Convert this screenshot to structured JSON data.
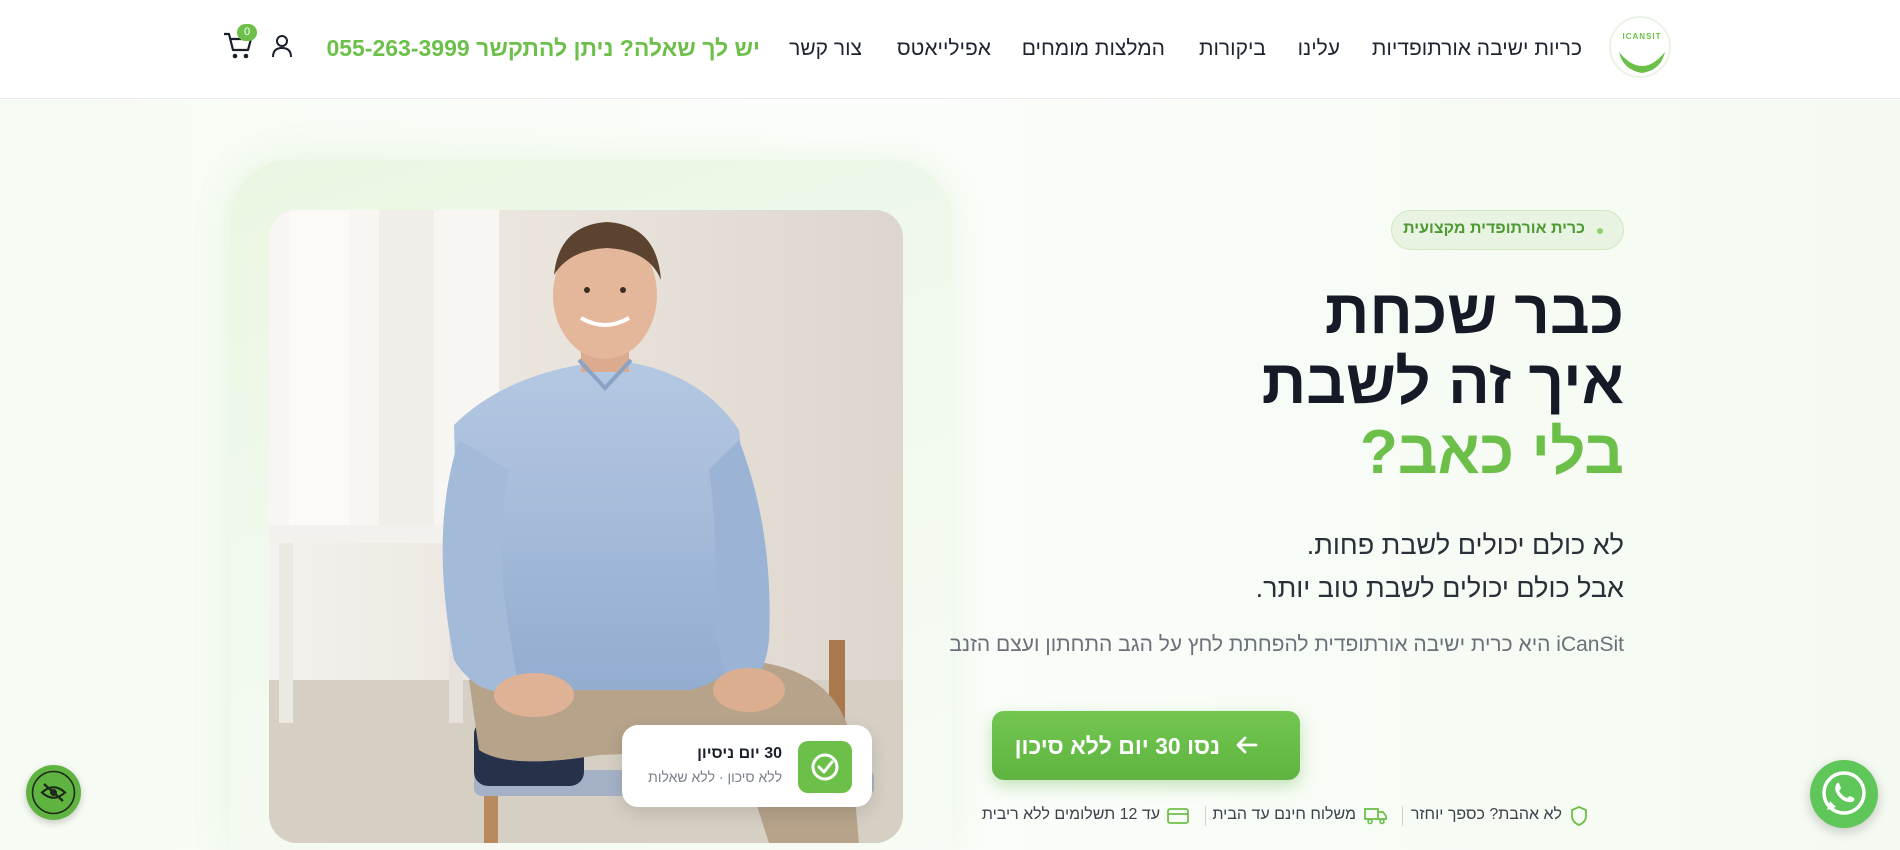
{
  "brand": {
    "logo_text": "ICANSIT",
    "accent_color": "#6cc04a"
  },
  "nav": {
    "items": [
      "כריות ישיבה אורתופדיות",
      "עלינו",
      "ביקורות",
      "המלצות מומחים",
      "אפילייאטס",
      "צור קשר"
    ],
    "phone_cta": "יש לך שאלה? ניתן להתקשר 055-263-3999",
    "cart_count": "0"
  },
  "hero": {
    "badge": "כרית אורתופדית מקצועית",
    "headline_line1": "כבר שכחת",
    "headline_line2": "איך זה לשבת",
    "headline_line3": "בלי כאב?",
    "subline1": "לא כולם יכולים לשבת פחות.",
    "subline2": "אבל כולם יכולים לשבת טוב יותר.",
    "description": "iCanSit היא כרית ישיבה אורתופדית להפחתת לחץ על הגב התחתון ועצם הזנב",
    "cta_label": "נסו 30 יום ללא סיכון",
    "trial_card": {
      "title": "30 יום ניסיון",
      "subtitle": "ללא סיכון · ללא שאלות"
    },
    "features": [
      {
        "label": "לא אהבת? כספך יוחזר",
        "icon": "shield-icon"
      },
      {
        "label": "משלוח חינם עד הבית",
        "icon": "truck-icon"
      },
      {
        "label": "עד 12 תשלומים ללא ריבית",
        "icon": "credit-card-icon"
      }
    ]
  },
  "floating": {
    "accessibility_icon": "eye-slash-icon",
    "whatsapp_icon": "whatsapp-icon"
  }
}
